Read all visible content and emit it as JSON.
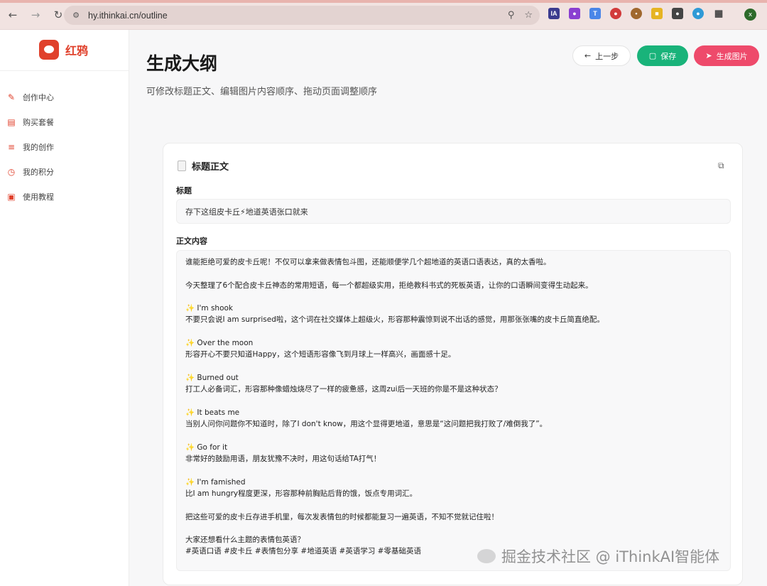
{
  "browser": {
    "url": "hy.ithinkai.cn/outline",
    "avatar_letter": "x"
  },
  "sidebar": {
    "brand": "红鸦",
    "items": [
      {
        "label": "创作中心",
        "icon": "pen-icon"
      },
      {
        "label": "购买套餐",
        "icon": "card-icon"
      },
      {
        "label": "我的创作",
        "icon": "list-icon"
      },
      {
        "label": "我的积分",
        "icon": "clock-icon"
      },
      {
        "label": "使用教程",
        "icon": "book-icon"
      }
    ]
  },
  "header": {
    "title": "生成大纲",
    "subtitle": "可修改标题正文、编辑图片内容顺序、拖动页面调整顺序",
    "back_label": "上一步",
    "save_label": "保存",
    "generate_label": "生成图片"
  },
  "card": {
    "title": "标题正文",
    "title_label": "标题",
    "title_value": "存下这组皮卡丘⚡地道英语张口就来",
    "content_label": "正文内容",
    "content_lines": [
      "谁能拒绝可爱的皮卡丘呢！不仅可以拿来做表情包斗图，还能顺便学几个超地道的英语口语表达，真的太香啦。",
      "",
      "今天整理了6个配合皮卡丘神态的常用短语，每一个都超级实用，拒绝教科书式的死板英语，让你的口语瞬间变得生动起来。",
      "",
      "✨ I'm shook",
      "不要只会说I am surprised啦，这个词在社交媒体上超级火，形容那种震惊到说不出话的感觉，用那张张嘴的皮卡丘简直绝配。",
      "",
      "✨ Over the moon",
      "形容开心不要只知道Happy，这个短语形容像飞到月球上一样高兴，画面感十足。",
      "",
      "✨ Burned out",
      "打工人必备词汇，形容那种像蜡烛烧尽了一样的疲惫感，这周zui后一天班的你是不是这种状态？",
      "",
      "✨ It beats me",
      "当别人问你问题你不知道时，除了I don't know，用这个显得更地道，意思是“这问题把我打败了/难倒我了”。",
      "",
      "✨ Go for it",
      "非常好的鼓励用语，朋友犹豫不决时，用这句话给TA打气！",
      "",
      "✨ I'm famished",
      "比I am hungry程度更深，形容那种前胸贴后背的饿，饭点专用词汇。",
      "",
      "把这些可爱的皮卡丘存进手机里，每次发表情包的时候都能复习一遍英语，不知不觉就记住啦！",
      "",
      "大家还想看什么主题的表情包英语？",
      "#英语口语 #皮卡丘 #表情包分享 #地道英语 #英语学习 #零基础英语"
    ]
  },
  "watermark": "掘金技术社区 @ iThinkAI智能体",
  "colors": {
    "brand": "#e0412c",
    "save": "#19b37a",
    "generate": "#ee4a6b"
  }
}
